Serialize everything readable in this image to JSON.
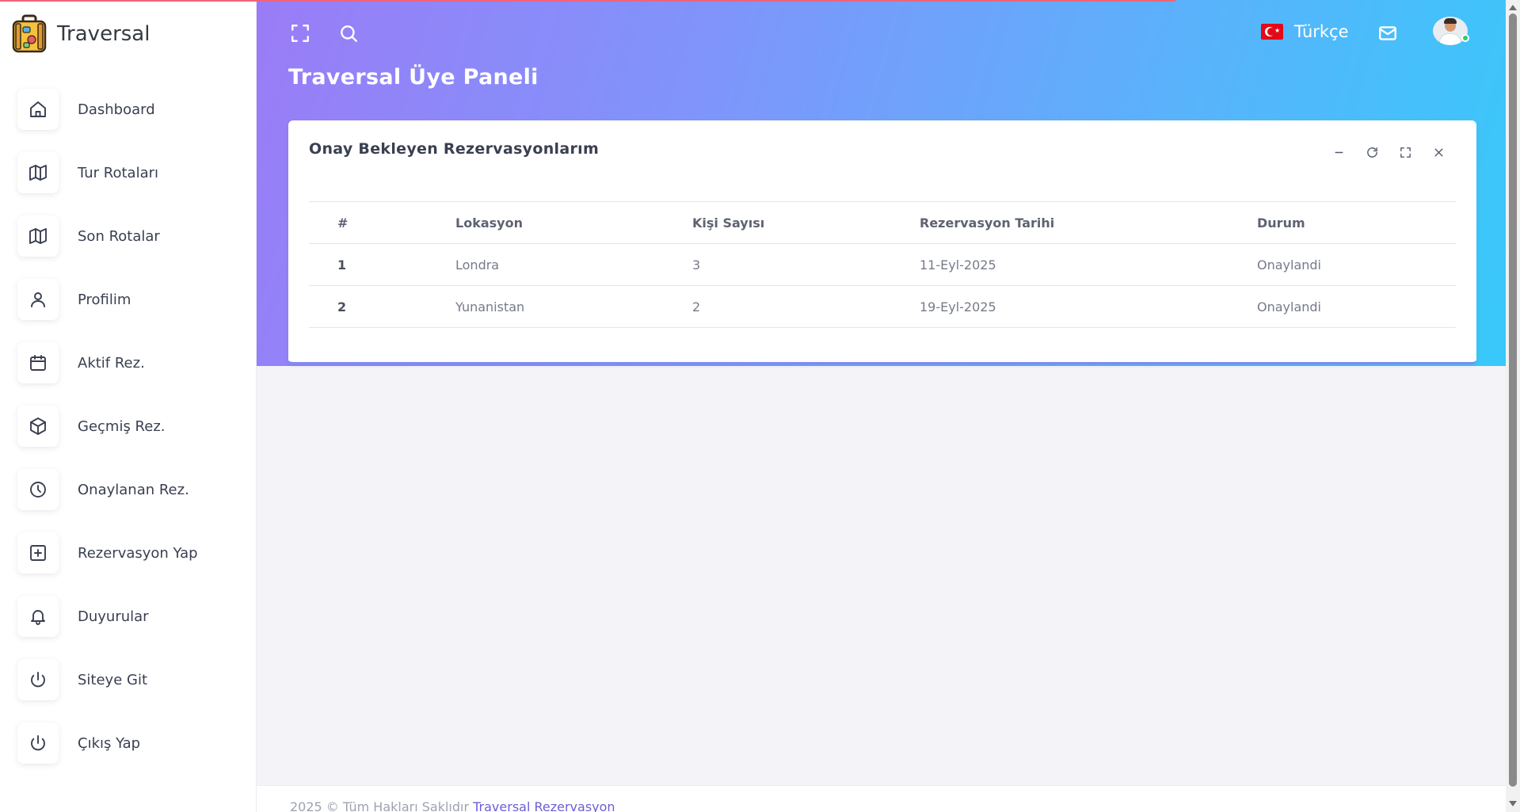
{
  "brand": {
    "name": "Traversal",
    "logo_icon": "suitcase-icon"
  },
  "sidebar": {
    "items": [
      {
        "label": "Dashboard",
        "icon": "home-icon"
      },
      {
        "label": "Tur Rotaları",
        "icon": "map-icon"
      },
      {
        "label": "Son Rotalar",
        "icon": "map-icon"
      },
      {
        "label": "Profilim",
        "icon": "user-icon"
      },
      {
        "label": "Aktif Rez.",
        "icon": "calendar-icon"
      },
      {
        "label": "Geçmiş Rez.",
        "icon": "box-icon"
      },
      {
        "label": "Onaylanan Rez.",
        "icon": "clock-icon"
      },
      {
        "label": "Rezervasyon Yap",
        "icon": "plus-square-icon"
      },
      {
        "label": "Duyurular",
        "icon": "bell-icon"
      },
      {
        "label": "Siteye Git",
        "icon": "power-icon"
      },
      {
        "label": "Çıkış Yap",
        "icon": "power-icon"
      }
    ]
  },
  "topbar": {
    "fullscreen_icon": "fullscreen-icon",
    "search_icon": "search-icon",
    "language": "Türkçe",
    "language_flag": "turkey-flag-icon",
    "mail_icon": "mail-icon",
    "avatar_status": "online"
  },
  "page": {
    "title": "Traversal Üye Paneli"
  },
  "card": {
    "title": "Onay Bekleyen Rezervasyonlarım",
    "tools": [
      "minimize-icon",
      "refresh-icon",
      "expand-icon",
      "close-icon"
    ],
    "accent_color": "#7d8cf6"
  },
  "table": {
    "headers": [
      "#",
      "Lokasyon",
      "Kişi Sayısı",
      "Rezervasyon Tarihi",
      "Durum"
    ],
    "rows": [
      {
        "no": "1",
        "location": "Londra",
        "people": "3",
        "date": "11-Eyl-2025",
        "status": "Onaylandi"
      },
      {
        "no": "2",
        "location": "Yunanistan",
        "people": "2",
        "date": "19-Eyl-2025",
        "status": "Onaylandi"
      }
    ]
  },
  "footer": {
    "text": "2025 © Tüm Hakları Saklıdır ",
    "link": "Traversal Rezervasyon"
  },
  "colors": {
    "gradient_start": "#9a7cf7",
    "gradient_end": "#38c9fa",
    "footer_link": "#6b5fd6"
  }
}
